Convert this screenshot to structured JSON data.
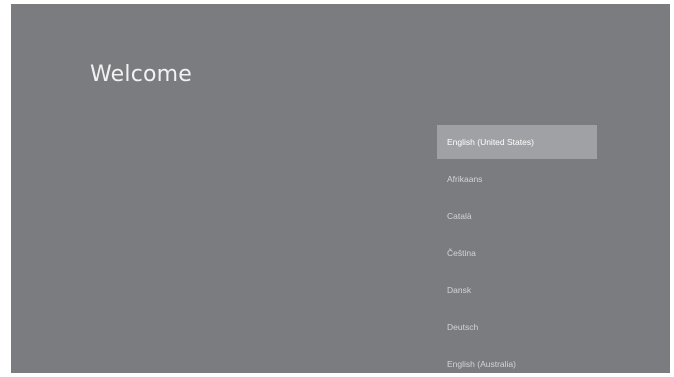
{
  "welcome": {
    "title": "Welcome"
  },
  "languages": {
    "items": [
      {
        "label": "English (United States)",
        "selected": true
      },
      {
        "label": "Afrikaans",
        "selected": false
      },
      {
        "label": "Català",
        "selected": false
      },
      {
        "label": "Čeština",
        "selected": false
      },
      {
        "label": "Dansk",
        "selected": false
      },
      {
        "label": "Deutsch",
        "selected": false
      },
      {
        "label": "English (Australia)",
        "selected": false
      }
    ]
  },
  "colors": {
    "background": "#7b7c7f",
    "selected_background": "#a0a1a4",
    "title_text": "#f1f2f3",
    "item_text": "#d3d4d6",
    "selected_text": "#ffffff"
  }
}
